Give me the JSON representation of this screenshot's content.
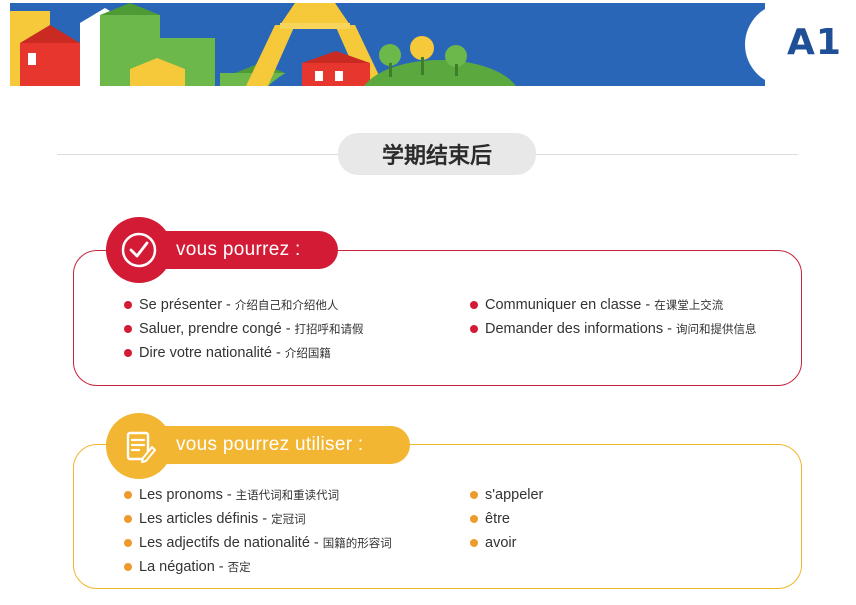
{
  "level_badge": "A1",
  "section_title": "学期结束后",
  "can_section": {
    "heading": "vous pourrez :",
    "left_items": [
      {
        "fr": "Se présenter",
        "zh": "介绍自己和介绍他人"
      },
      {
        "fr": "Saluer, prendre congé",
        "zh": "打招呼和请假"
      },
      {
        "fr": "Dire votre nationalité",
        "zh": "介绍国籍"
      }
    ],
    "right_items": [
      {
        "fr": "Communiquer en classe",
        "zh": "在课堂上交流"
      },
      {
        "fr": "Demander des informations",
        "zh": "询问和提供信息"
      }
    ]
  },
  "use_section": {
    "heading": "vous pourrez utiliser :",
    "left_items": [
      {
        "fr": "Les pronoms",
        "zh": "主语代词和重读代词"
      },
      {
        "fr": "Les articles définis",
        "zh": "定冠词"
      },
      {
        "fr": "Les adjectifs de nationalité",
        "zh": "国籍的形容词"
      },
      {
        "fr": "La négation",
        "zh": "否定"
      }
    ],
    "right_items": [
      {
        "fr": "s'appeler"
      },
      {
        "fr": "être"
      },
      {
        "fr": "avoir"
      }
    ]
  },
  "colors": {
    "banner_blue": "#2a66b8",
    "accent_red": "#d31b36",
    "accent_yellow": "#f2b632",
    "bullet_orange": "#ef9a2c"
  },
  "icons": {
    "can_section": "check-circle-icon",
    "use_section": "notepad-pencil-icon"
  }
}
